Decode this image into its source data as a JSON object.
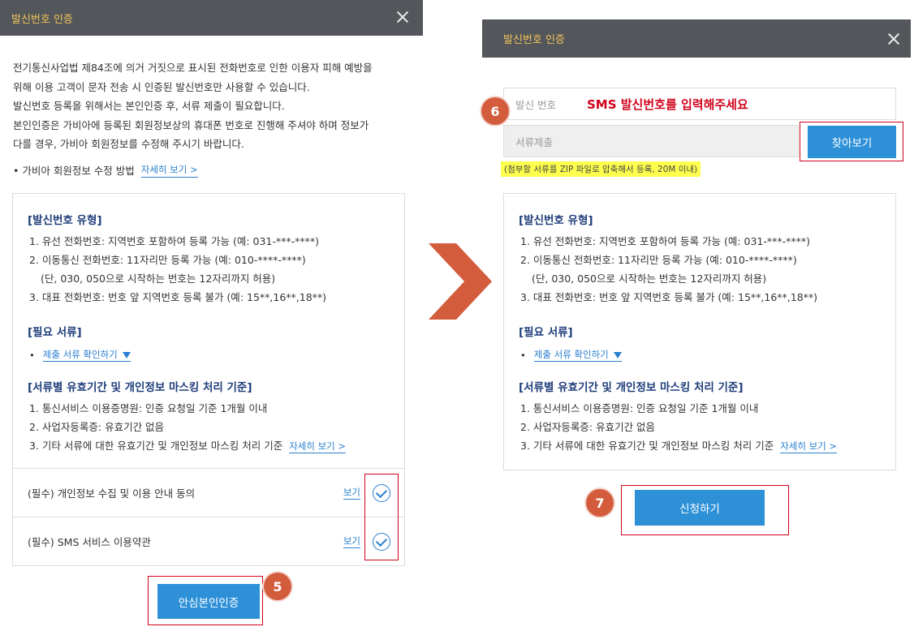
{
  "left": {
    "header_title": "발신번호 인증",
    "intro_lines": [
      "전기통신사업법 제84조에 의거 거짓으로 표시된 전화번호로 인한 이용자 피해 예방을",
      "위해 이용 고객이 문자 전송 시 인증된 발신번호만 사용할 수 있습니다.",
      "발신번호 등록을 위해서는 본인인증 후, 서류 제출이 필요합니다.",
      "본인인증은 가비아에 등록된 회원정보상의 휴대폰 번호로 진행해 주셔야 하며 정보가",
      "다를 경우, 가비아 회원정보를 수정해 주시기 바랍니다."
    ],
    "guide_bullet": "• 가비아 회원정보 수정 방법",
    "guide_link": "자세히 보기 >",
    "sections": {
      "type_title": "[발신번호 유형]",
      "type_lines": [
        "1. 유선 전화번호: 지역번호 포함하여 등록 가능 (예: 031-***-****)",
        "2. 이동통신 전화번호: 11자리만 등록 가능 (예: 010-****-****)",
        "(단, 030, 050으로 시작하는 번호는 12자리까지 허용)",
        "3. 대표 전화번호: 번호 앞 지역번호 등록 불가 (예: 15**,16**,18**)"
      ],
      "docs_title": "[필요 서류]",
      "docs_bullet": "•",
      "docs_link": "제출 서류 확인하기",
      "validity_title": "[서류별 유효기간 및 개인정보 마스킹 처리 기준]",
      "validity_lines": [
        "1. 통신서비스 이용증명원: 인증 요청일 기준 1개월 이내",
        "2. 사업자등록증: 유효기간 없음",
        "3. 기타 서류에 대한 유효기간 및 개인정보 마스킹 처리 기준"
      ],
      "validity_link": "자세히 보기 >"
    },
    "agreements": [
      {
        "label": "(필수) 개인정보 수집 및 이용 안내 동의",
        "view": "보기"
      },
      {
        "label": "(필수) SMS 서비스 이용약관",
        "view": "보기"
      }
    ],
    "verify_button": "안심본인인증",
    "step_badge": "5"
  },
  "right": {
    "header_title": "발신번호 인증",
    "phone_label": "발신 번호",
    "phone_placeholder": "SMS 발신번호를 입력해주세요",
    "doc_placeholder": "서류제출",
    "browse_button": "찾아보기",
    "hint": "(첨부할 서류를 ZIP 파일로 압축해서 등록, 20M 이내)",
    "step_badge_6": "6",
    "step_badge_7": "7",
    "apply_button": "신청하기"
  },
  "colors": {
    "header_bg": "#53565a",
    "header_title": "#f2c45a",
    "accent_blue": "#2e91d8",
    "section_title": "#1f3d7a",
    "highlight_red": "#d0021b",
    "badge": "#d35c3c",
    "arrow": "#d35c3c",
    "hint_bg": "#ffff4d"
  },
  "icons": {
    "close": "close-icon",
    "check": "check-circle-icon",
    "arrow": "chevron-right-arrow-icon",
    "dropdown": "triangle-down-icon"
  }
}
